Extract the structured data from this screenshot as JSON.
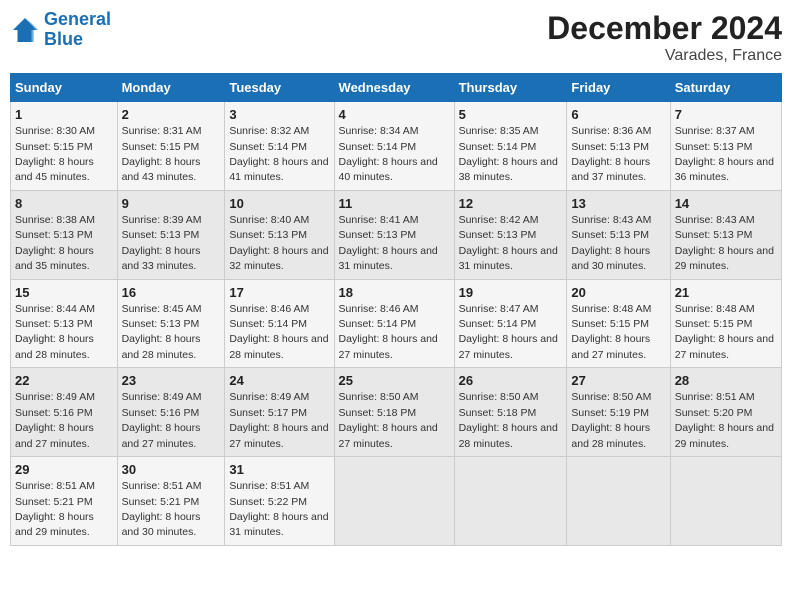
{
  "header": {
    "logo_line1": "General",
    "logo_line2": "Blue",
    "title": "December 2024",
    "subtitle": "Varades, France"
  },
  "columns": [
    "Sunday",
    "Monday",
    "Tuesday",
    "Wednesday",
    "Thursday",
    "Friday",
    "Saturday"
  ],
  "weeks": [
    [
      {
        "day": "1",
        "sunrise": "Sunrise: 8:30 AM",
        "sunset": "Sunset: 5:15 PM",
        "daylight": "Daylight: 8 hours and 45 minutes."
      },
      {
        "day": "2",
        "sunrise": "Sunrise: 8:31 AM",
        "sunset": "Sunset: 5:15 PM",
        "daylight": "Daylight: 8 hours and 43 minutes."
      },
      {
        "day": "3",
        "sunrise": "Sunrise: 8:32 AM",
        "sunset": "Sunset: 5:14 PM",
        "daylight": "Daylight: 8 hours and 41 minutes."
      },
      {
        "day": "4",
        "sunrise": "Sunrise: 8:34 AM",
        "sunset": "Sunset: 5:14 PM",
        "daylight": "Daylight: 8 hours and 40 minutes."
      },
      {
        "day": "5",
        "sunrise": "Sunrise: 8:35 AM",
        "sunset": "Sunset: 5:14 PM",
        "daylight": "Daylight: 8 hours and 38 minutes."
      },
      {
        "day": "6",
        "sunrise": "Sunrise: 8:36 AM",
        "sunset": "Sunset: 5:13 PM",
        "daylight": "Daylight: 8 hours and 37 minutes."
      },
      {
        "day": "7",
        "sunrise": "Sunrise: 8:37 AM",
        "sunset": "Sunset: 5:13 PM",
        "daylight": "Daylight: 8 hours and 36 minutes."
      }
    ],
    [
      {
        "day": "8",
        "sunrise": "Sunrise: 8:38 AM",
        "sunset": "Sunset: 5:13 PM",
        "daylight": "Daylight: 8 hours and 35 minutes."
      },
      {
        "day": "9",
        "sunrise": "Sunrise: 8:39 AM",
        "sunset": "Sunset: 5:13 PM",
        "daylight": "Daylight: 8 hours and 33 minutes."
      },
      {
        "day": "10",
        "sunrise": "Sunrise: 8:40 AM",
        "sunset": "Sunset: 5:13 PM",
        "daylight": "Daylight: 8 hours and 32 minutes."
      },
      {
        "day": "11",
        "sunrise": "Sunrise: 8:41 AM",
        "sunset": "Sunset: 5:13 PM",
        "daylight": "Daylight: 8 hours and 31 minutes."
      },
      {
        "day": "12",
        "sunrise": "Sunrise: 8:42 AM",
        "sunset": "Sunset: 5:13 PM",
        "daylight": "Daylight: 8 hours and 31 minutes."
      },
      {
        "day": "13",
        "sunrise": "Sunrise: 8:43 AM",
        "sunset": "Sunset: 5:13 PM",
        "daylight": "Daylight: 8 hours and 30 minutes."
      },
      {
        "day": "14",
        "sunrise": "Sunrise: 8:43 AM",
        "sunset": "Sunset: 5:13 PM",
        "daylight": "Daylight: 8 hours and 29 minutes."
      }
    ],
    [
      {
        "day": "15",
        "sunrise": "Sunrise: 8:44 AM",
        "sunset": "Sunset: 5:13 PM",
        "daylight": "Daylight: 8 hours and 28 minutes."
      },
      {
        "day": "16",
        "sunrise": "Sunrise: 8:45 AM",
        "sunset": "Sunset: 5:13 PM",
        "daylight": "Daylight: 8 hours and 28 minutes."
      },
      {
        "day": "17",
        "sunrise": "Sunrise: 8:46 AM",
        "sunset": "Sunset: 5:14 PM",
        "daylight": "Daylight: 8 hours and 28 minutes."
      },
      {
        "day": "18",
        "sunrise": "Sunrise: 8:46 AM",
        "sunset": "Sunset: 5:14 PM",
        "daylight": "Daylight: 8 hours and 27 minutes."
      },
      {
        "day": "19",
        "sunrise": "Sunrise: 8:47 AM",
        "sunset": "Sunset: 5:14 PM",
        "daylight": "Daylight: 8 hours and 27 minutes."
      },
      {
        "day": "20",
        "sunrise": "Sunrise: 8:48 AM",
        "sunset": "Sunset: 5:15 PM",
        "daylight": "Daylight: 8 hours and 27 minutes."
      },
      {
        "day": "21",
        "sunrise": "Sunrise: 8:48 AM",
        "sunset": "Sunset: 5:15 PM",
        "daylight": "Daylight: 8 hours and 27 minutes."
      }
    ],
    [
      {
        "day": "22",
        "sunrise": "Sunrise: 8:49 AM",
        "sunset": "Sunset: 5:16 PM",
        "daylight": "Daylight: 8 hours and 27 minutes."
      },
      {
        "day": "23",
        "sunrise": "Sunrise: 8:49 AM",
        "sunset": "Sunset: 5:16 PM",
        "daylight": "Daylight: 8 hours and 27 minutes."
      },
      {
        "day": "24",
        "sunrise": "Sunrise: 8:49 AM",
        "sunset": "Sunset: 5:17 PM",
        "daylight": "Daylight: 8 hours and 27 minutes."
      },
      {
        "day": "25",
        "sunrise": "Sunrise: 8:50 AM",
        "sunset": "Sunset: 5:18 PM",
        "daylight": "Daylight: 8 hours and 27 minutes."
      },
      {
        "day": "26",
        "sunrise": "Sunrise: 8:50 AM",
        "sunset": "Sunset: 5:18 PM",
        "daylight": "Daylight: 8 hours and 28 minutes."
      },
      {
        "day": "27",
        "sunrise": "Sunrise: 8:50 AM",
        "sunset": "Sunset: 5:19 PM",
        "daylight": "Daylight: 8 hours and 28 minutes."
      },
      {
        "day": "28",
        "sunrise": "Sunrise: 8:51 AM",
        "sunset": "Sunset: 5:20 PM",
        "daylight": "Daylight: 8 hours and 29 minutes."
      }
    ],
    [
      {
        "day": "29",
        "sunrise": "Sunrise: 8:51 AM",
        "sunset": "Sunset: 5:21 PM",
        "daylight": "Daylight: 8 hours and 29 minutes."
      },
      {
        "day": "30",
        "sunrise": "Sunrise: 8:51 AM",
        "sunset": "Sunset: 5:21 PM",
        "daylight": "Daylight: 8 hours and 30 minutes."
      },
      {
        "day": "31",
        "sunrise": "Sunrise: 8:51 AM",
        "sunset": "Sunset: 5:22 PM",
        "daylight": "Daylight: 8 hours and 31 minutes."
      },
      null,
      null,
      null,
      null
    ]
  ]
}
